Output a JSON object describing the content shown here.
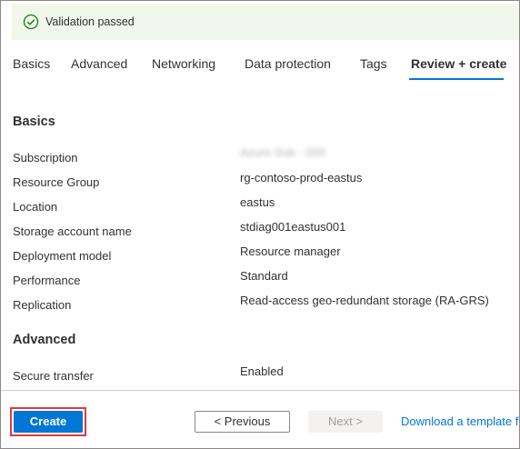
{
  "banner": {
    "message": "Validation passed",
    "icon": "check-circle-icon",
    "color": "#107c10"
  },
  "tabs": [
    {
      "label": "Basics"
    },
    {
      "label": "Advanced"
    },
    {
      "label": "Networking"
    },
    {
      "label": "Data protection"
    },
    {
      "label": "Tags"
    },
    {
      "label": "Review + create",
      "active": true
    }
  ],
  "sections": {
    "basics": {
      "title": "Basics",
      "rows": [
        {
          "label": "Subscription",
          "value": "Azure Sub - 000"
        },
        {
          "label": "Resource Group",
          "value": "rg-contoso-prod-eastus"
        },
        {
          "label": "Location",
          "value": "eastus"
        },
        {
          "label": "Storage account name",
          "value": "stdiag001eastus001"
        },
        {
          "label": "Deployment model",
          "value": "Resource manager"
        },
        {
          "label": "Performance",
          "value": "Standard"
        },
        {
          "label": "Replication",
          "value": "Read-access geo-redundant storage (RA-GRS)"
        }
      ]
    },
    "advanced": {
      "title": "Advanced",
      "rows": [
        {
          "label": "Secure transfer",
          "value": "Enabled"
        }
      ]
    }
  },
  "footer": {
    "create_label": "Create",
    "previous_label": "< Previous",
    "next_label": "Next >",
    "template_link": "Download a template for automation"
  },
  "colors": {
    "accent": "#0078d4",
    "highlight_outline": "#e0393e",
    "banner_bg": "#f1f7ea"
  }
}
